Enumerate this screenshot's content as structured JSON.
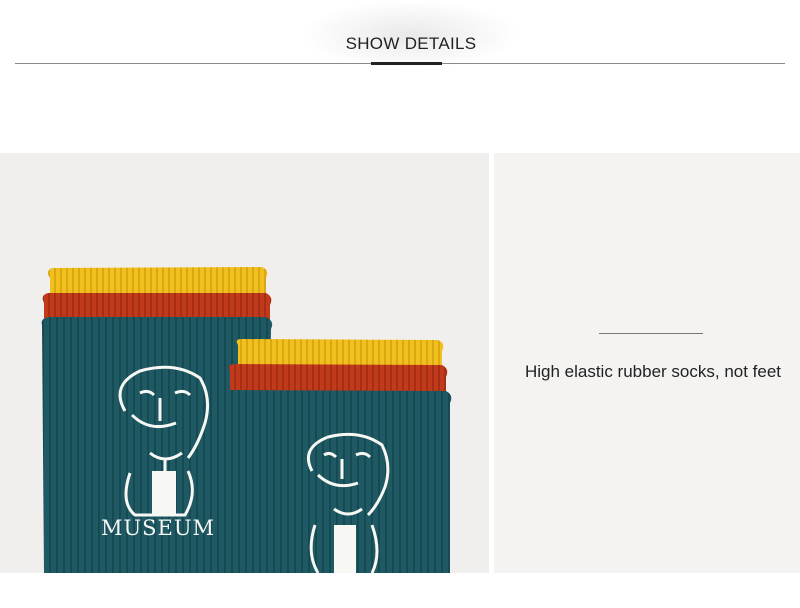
{
  "header": {
    "title": "SHOW DETAILS"
  },
  "detail": {
    "caption": "High elastic rubber socks, not feet",
    "print_text": "MUSEUM"
  },
  "colors": {
    "sock_teal": "#1f5a64",
    "cuff_yellow": "#f2c01e",
    "cuff_red": "#c13a1c",
    "print_white": "#f7f7f4"
  }
}
